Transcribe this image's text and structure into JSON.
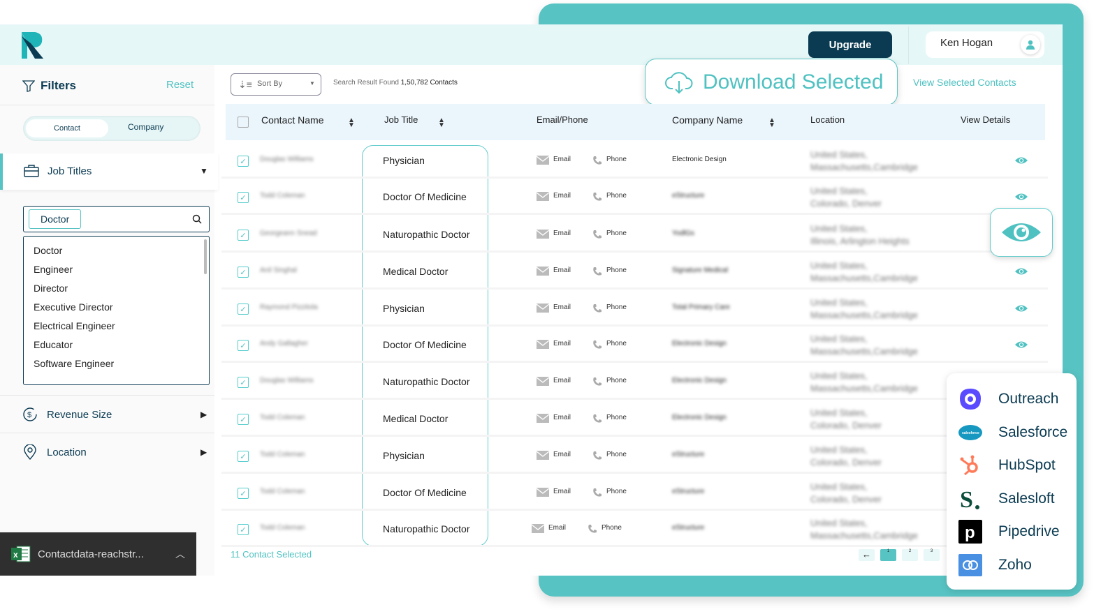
{
  "colors": {
    "teal": "#58c3c3",
    "navy": "#0b3b52",
    "header_bg": "#e6f7f7"
  },
  "header": {
    "upgrade_label": "Upgrade",
    "user_name": "Ken Hogan"
  },
  "sidebar": {
    "filters_label": "Filters",
    "reset_label": "Reset",
    "toggle": {
      "contact": "Contact",
      "company": "Company",
      "active": "Contact"
    },
    "job_titles_label": "Job Titles",
    "search_value": "Doctor",
    "dropdown_options": [
      "Doctor",
      "Engineer",
      "Director",
      "Executive Director",
      "Electrical Engineer",
      "Educator",
      "Software Engineer"
    ],
    "revenue_label": "Revenue Size",
    "location_label": "Location"
  },
  "toolbar": {
    "sort_label": "Sort By",
    "result_prefix": "Search Result Found",
    "result_count": "1,50,782 Contacts",
    "download_label": "Download Selected",
    "view_selected_label": "View Selected Contacts"
  },
  "table": {
    "headers": {
      "contact": "Contact Name",
      "job": "Job Title",
      "email_phone": "Email/Phone",
      "company": "Company Name",
      "location": "Location",
      "details": "View Details"
    },
    "email_label": "Email",
    "phone_label": "Phone",
    "rows": [
      {
        "name": "Douglas Williams",
        "job": "Physician",
        "company": "Electronic Design",
        "loc1": "United States,",
        "loc2": "Massachusetts,Cambridge"
      },
      {
        "name": "Todd Coleman",
        "job": "Doctor Of Medicine",
        "company": "eStructure",
        "loc1": "United States,",
        "loc2": "Colorado, Denver"
      },
      {
        "name": "Georgeann Snead",
        "job": "Naturopathic Doctor",
        "company": "YodlGs",
        "loc1": "United States,",
        "loc2": "Illinois, Arlington Heights"
      },
      {
        "name": "Anil Singhal",
        "job": "Medical Doctor",
        "company": "Signature Medical",
        "loc1": "United States,",
        "loc2": "Massachusetts,Cambridge"
      },
      {
        "name": "Raymond Pizzitola",
        "job": "Physician",
        "company": "Total Primary Care",
        "loc1": "United States,",
        "loc2": "Massachusetts,Cambridge"
      },
      {
        "name": "Andy Gallagher",
        "job": "Doctor Of Medicine",
        "company": "Electronic Design",
        "loc1": "United States,",
        "loc2": "Massachusetts,Cambridge"
      },
      {
        "name": "Douglas Williams",
        "job": "Naturopathic Doctor",
        "company": "Electronic Design",
        "loc1": "United States,",
        "loc2": "Massachusetts,Cambridge"
      },
      {
        "name": "Todd Coleman",
        "job": "Medical Doctor",
        "company": "Electronic Design",
        "loc1": "United States,",
        "loc2": "Colorado, Denver"
      },
      {
        "name": "Todd Coleman",
        "job": "Physician",
        "company": "eStructure",
        "loc1": "United States,",
        "loc2": "Colorado, Denver"
      },
      {
        "name": "Todd Coleman",
        "job": "Doctor Of Medicine",
        "company": "eStructure",
        "loc1": "United States,",
        "loc2": "Colorado, Denver"
      },
      {
        "name": "Todd Coleman",
        "job": "Naturopathic Doctor",
        "company": "eStructure",
        "loc1": "United States,",
        "loc2": "Massachusetts,Cambridge"
      }
    ]
  },
  "footer": {
    "selected_label": "11 Contact Selected",
    "pages": [
      "1",
      "2",
      "3"
    ],
    "current_page": "1"
  },
  "crm": [
    {
      "name": "Outreach",
      "icon": "outreach-icon"
    },
    {
      "name": "Salesforce",
      "icon": "salesforce-icon"
    },
    {
      "name": "HubSpot",
      "icon": "hubspot-icon"
    },
    {
      "name": "Salesloft",
      "icon": "salesloft-icon"
    },
    {
      "name": "Pipedrive",
      "icon": "pipedrive-icon"
    },
    {
      "name": "Zoho",
      "icon": "zoho-icon"
    }
  ],
  "excel": {
    "filename": "Contactdata-reachstr..."
  }
}
